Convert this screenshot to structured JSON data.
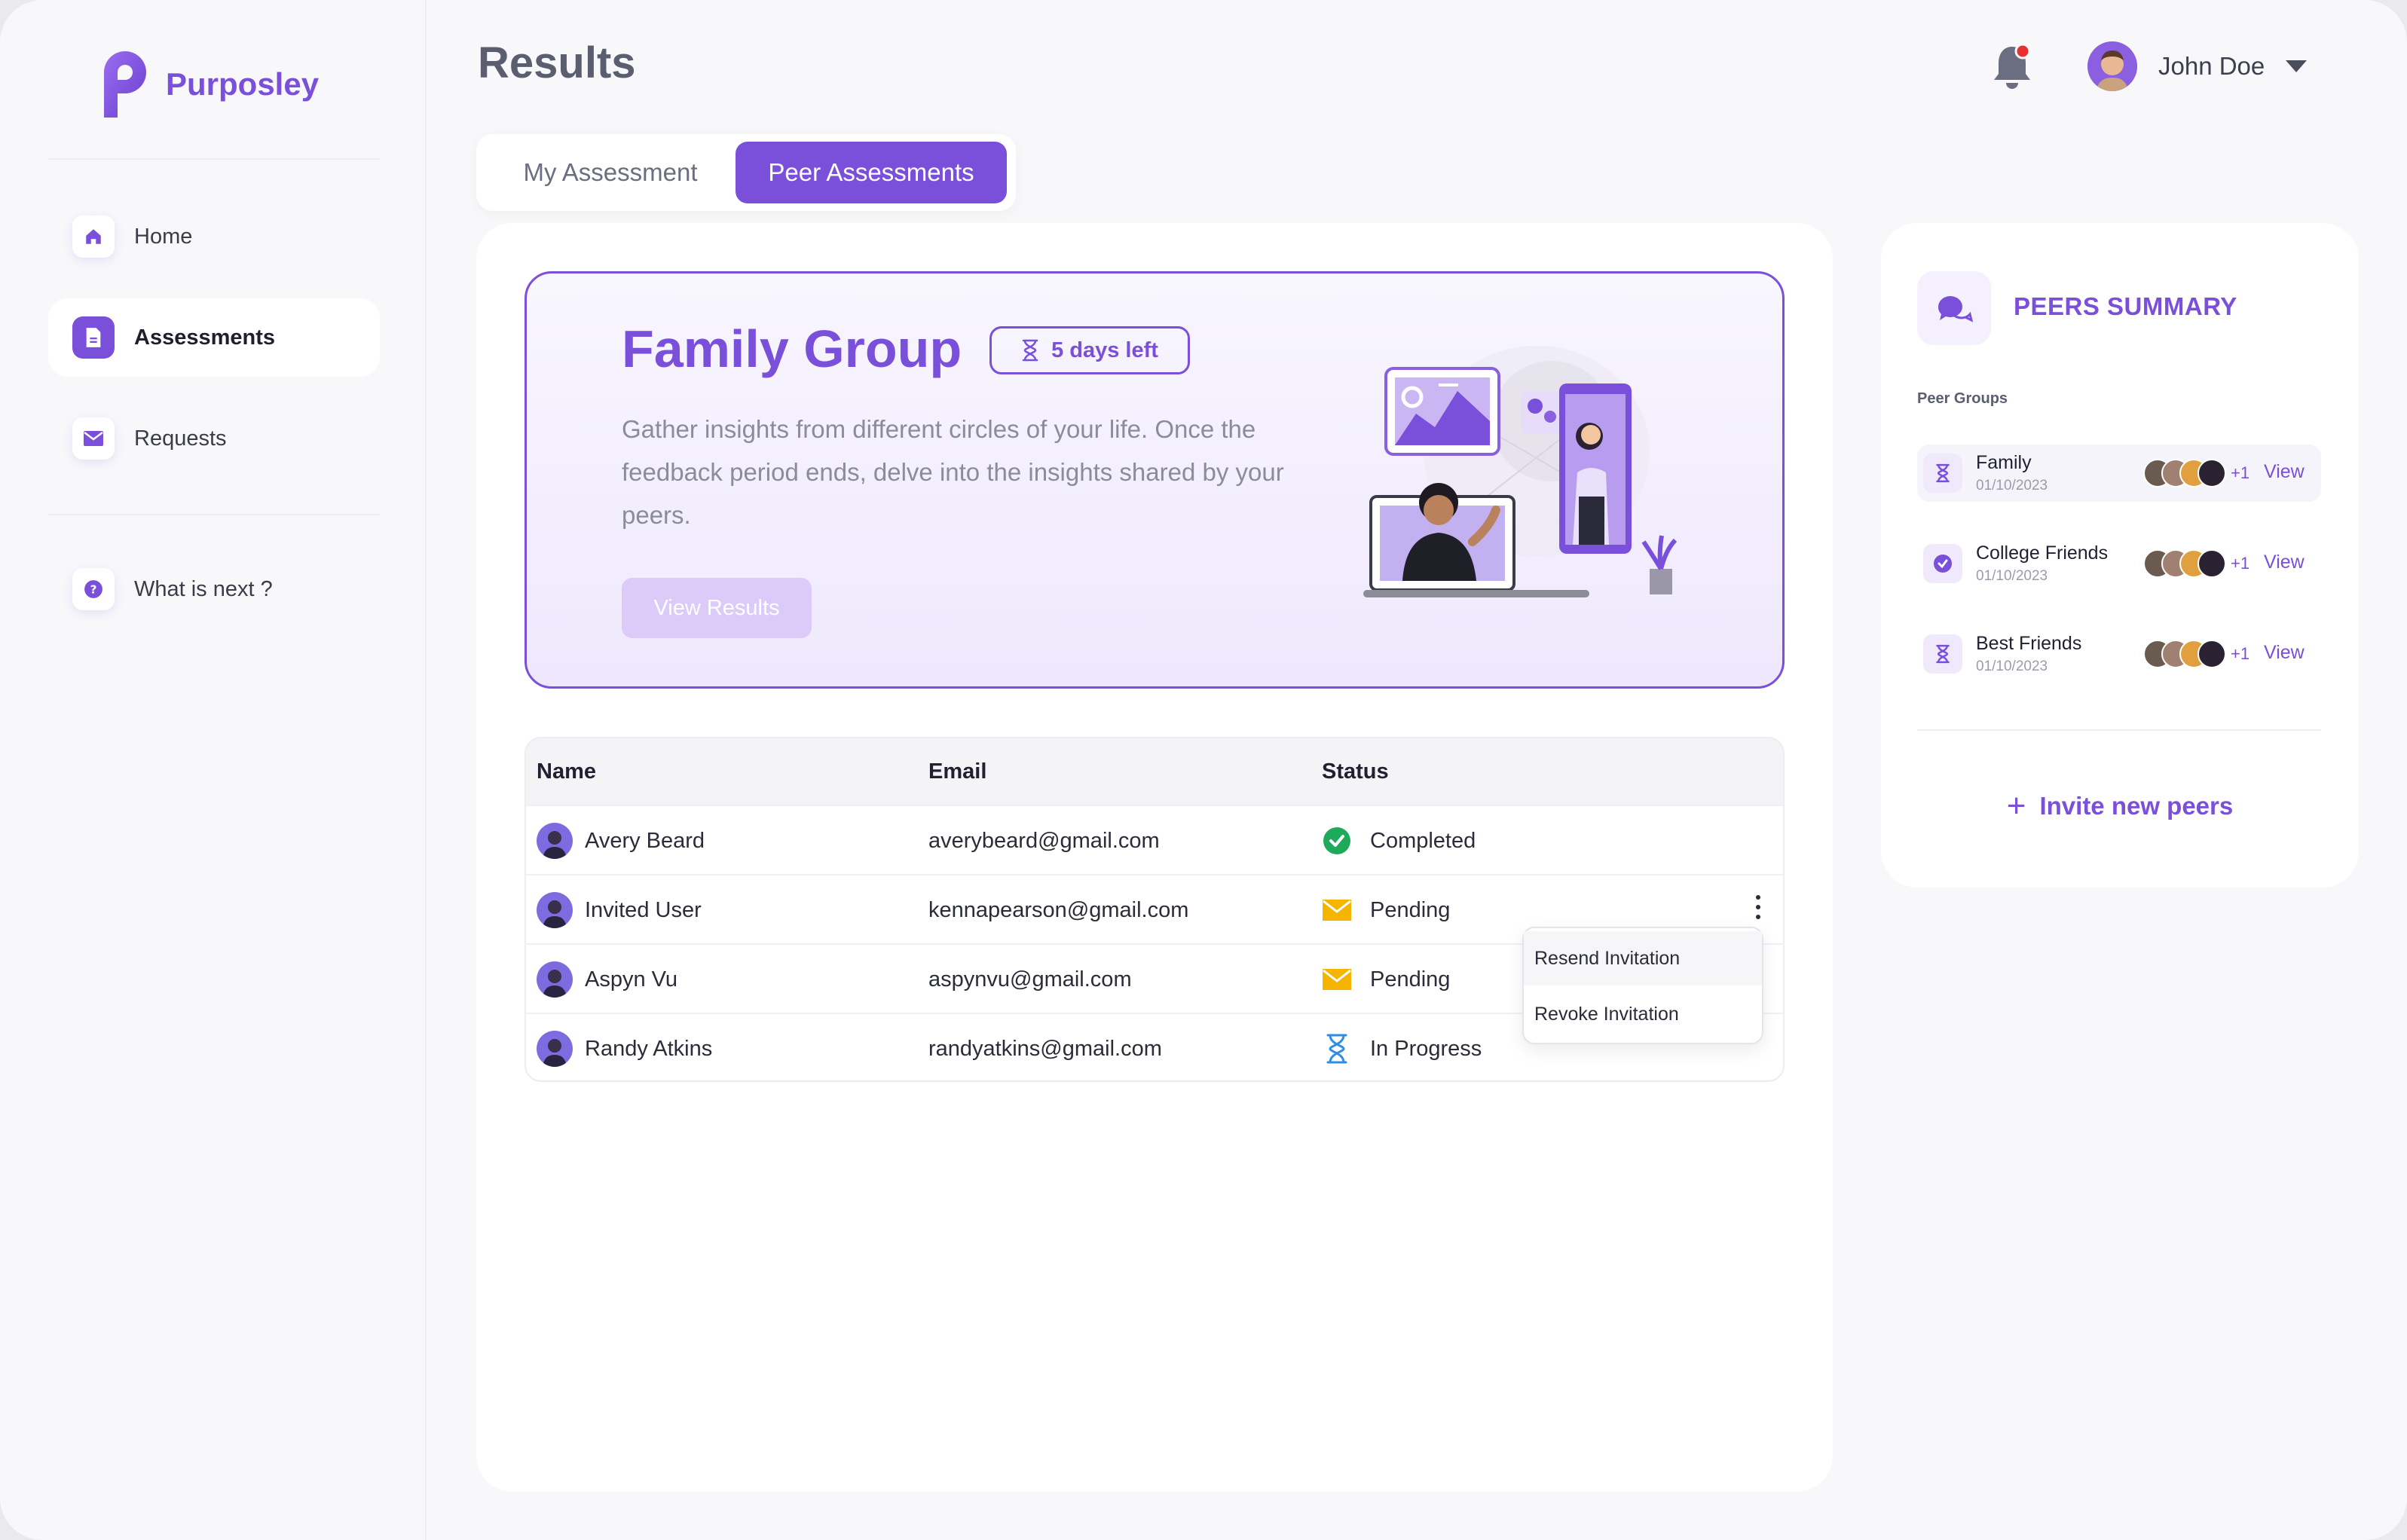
{
  "app": {
    "name": "Purposley",
    "brand_color": "#7a4fd9"
  },
  "sidebar": {
    "items": [
      {
        "label": "Home",
        "icon": "home-icon"
      },
      {
        "label": "Assessments",
        "icon": "document-icon",
        "active": true
      },
      {
        "label": "Requests",
        "icon": "mail-icon"
      },
      {
        "label": "What is next ?",
        "icon": "help-icon"
      }
    ]
  },
  "header": {
    "title": "Results",
    "user_name": "John Doe",
    "notification_icon": "bell-icon"
  },
  "tabs": [
    {
      "label": "My Assessment",
      "active": false
    },
    {
      "label": "Peer Assessments",
      "active": true
    }
  ],
  "hero": {
    "title": "Family Group",
    "badge": "5 days left",
    "description": "Gather insights from different circles of your life. Once the feedback period ends, delve into the insights shared by your peers.",
    "button": "View Results"
  },
  "table": {
    "columns": [
      "Name",
      "Email",
      "Status"
    ],
    "rows": [
      {
        "name": "Avery Beard",
        "email": "averybeard@gmail.com",
        "status": "Completed",
        "status_icon": "check-circle-icon"
      },
      {
        "name": "Invited User",
        "email": "kennapearson@gmail.com",
        "status": "Pending",
        "status_icon": "envelope-icon"
      },
      {
        "name": "Aspyn Vu",
        "email": "aspynvu@gmail.com",
        "status": "Pending",
        "status_icon": "envelope-icon"
      },
      {
        "name": "Randy Atkins",
        "email": "randyatkins@gmail.com",
        "status": "In Progress",
        "status_icon": "hourglass-icon"
      }
    ]
  },
  "row_menu": {
    "items": [
      "Resend Invitation",
      "Revoke Invitation"
    ]
  },
  "peers_summary": {
    "title": "PEERS SUMMARY",
    "groups_label": "Peer Groups",
    "groups": [
      {
        "name": "Family",
        "date": "01/10/2023",
        "extra": "+1",
        "action": "View",
        "icon": "hourglass-icon"
      },
      {
        "name": "College Friends",
        "date": "01/10/2023",
        "extra": "+1",
        "action": "View",
        "icon": "check-circle-icon"
      },
      {
        "name": "Best Friends",
        "date": "01/10/2023",
        "extra": "+1",
        "action": "View",
        "icon": "hourglass-icon"
      }
    ],
    "invite_label": "Invite new peers"
  }
}
